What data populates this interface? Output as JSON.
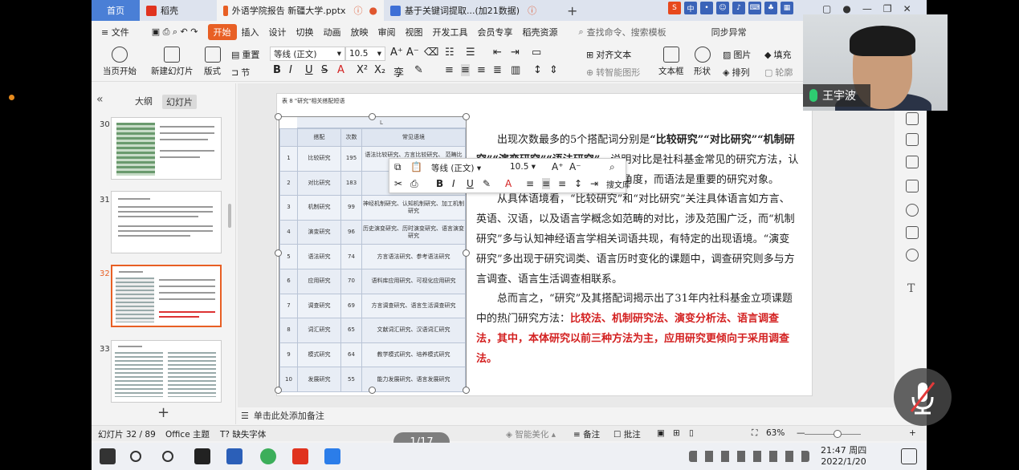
{
  "titlebar": {
    "home_tab": "首页",
    "tabs": [
      {
        "label": "稻壳",
        "icon_color": "#e0331f"
      },
      {
        "label": "外语学院报告 新疆大学.pptx",
        "icon_color": "#e85f24",
        "active": true
      },
      {
        "label": "基于关键词提取...(加21数据)",
        "icon_color": "#3d6fd6"
      }
    ],
    "add_tab": "+"
  },
  "menu": {
    "file": "≡ 文件",
    "items": [
      "开始",
      "插入",
      "设计",
      "切换",
      "动画",
      "放映",
      "审阅",
      "视图",
      "开发工具",
      "会员专享",
      "稻壳资源"
    ],
    "active": "开始",
    "search_placeholder": "查找命令、搜索模板",
    "sync": "同步异常"
  },
  "ribbon": {
    "play": "当页开始",
    "new_slide": "新建幻灯片",
    "layout": "版式",
    "reset": "重置",
    "section": "节",
    "font": "等线 (正文)",
    "font_size": "10.5",
    "align_text": "对齐文本",
    "smart_graphic": "转智能图形",
    "textbox": "文本框",
    "shape": "形状",
    "picture": "图片",
    "arrange": "排列",
    "fill": "填充",
    "outline": "轮廓"
  },
  "left_panel": {
    "tab_outline": "大纲",
    "tab_slides": "幻灯片",
    "slides": [
      "30",
      "31",
      "32",
      "33"
    ],
    "selected": "32",
    "add": "+"
  },
  "slide": {
    "caption": "表 8 \"研究\"相关搭配短语",
    "table_head_letter": "L",
    "columns": [
      "",
      "搭配",
      "次数",
      "常见语境"
    ],
    "rows": [
      [
        "1",
        "比较研究",
        "195",
        "语法比较研究、方言比较研究、 范畴比较研究"
      ],
      [
        "2",
        "对比研究",
        "183",
        "认知对比研究"
      ],
      [
        "3",
        "机制研究",
        "99",
        "神经机制研究、认知机制研究、加工机制研究"
      ],
      [
        "4",
        "演变研究",
        "96",
        "历史演变研究、历时演变研究、语言演变研究"
      ],
      [
        "5",
        "语法研究",
        "74",
        "方言语法研究、参考语法研究"
      ],
      [
        "6",
        "应用研究",
        "70",
        "语料库应用研究、可视化应用研究"
      ],
      [
        "7",
        "调查研究",
        "69",
        "方言调查研究、语言生活调查研究"
      ],
      [
        "8",
        "词汇研究",
        "65",
        "文献词汇研究、汉语词汇研究"
      ],
      [
        "9",
        "模式研究",
        "64",
        "教学模式研究、培养模式研究"
      ],
      [
        "10",
        "发展研究",
        "55",
        "能力发展研究、语言发展研究"
      ]
    ],
    "para1_a": "出现次数最多的5个搭配词分别是",
    "para1_b": "“比较研究”“对比研究”“机制研究”“演变研究”“语法研究”",
    "para1_c": "，说明对比是社科基金常见的研究方法，认知机制与演变路径是常见的研究角度，而语法是重要的研究对象。",
    "para2": "从具体语境看，“比较研究”和“对比研究”关注具体语言如方言、英语、汉语，以及语言学概念如范畴的对比，涉及范围广泛，而“机制研究”多与认知神经语言学相关词语共现，有特定的出现语境。“演变研究”多出现于研究词类、语言历时变化的课题中，调查研究则多与方言调查、语言生活调查相联系。",
    "para3_a": "总而言之，“研究”及其搭配词揭示出了31年内社科基金立项课题中的热门研究方法：",
    "para3_b": "比较法、机制研究法、演变分析法、语言调查法，其中，本体研究以前三种方法为主，应用研究更倾向于采用调查法。"
  },
  "float_toolbar": {
    "font": "等线 (正文)",
    "size": "10.5",
    "search_lib": "搜文库"
  },
  "notes": "单击此处添加备注",
  "status": {
    "slide_pos": "幻灯片 32 / 89",
    "theme": "Office 主题",
    "missing_font": "缺失字体",
    "beautify": "智能美化",
    "notes": "备注",
    "comments": "批注",
    "zoom": "63%",
    "page_badge": "1/17"
  },
  "webcam": {
    "name": "王宇波"
  },
  "taskbar": {
    "time": "21:47 周四",
    "date": "2022/1/20"
  }
}
